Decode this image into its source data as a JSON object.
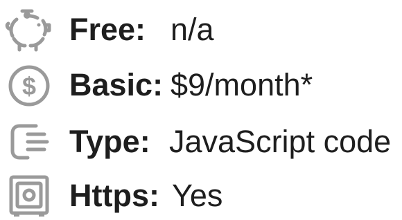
{
  "colors": {
    "icon": "#9a9a9a",
    "text": "#1e1e1e"
  },
  "rows": [
    {
      "icon": "piggy-bank-icon",
      "label": "Free:",
      "value": "n/a"
    },
    {
      "icon": "dollar-coin-icon",
      "label": "Basic:",
      "value": "$9/month*"
    },
    {
      "icon": "hand-code-icon",
      "label": "Type:",
      "value": "JavaScript code"
    },
    {
      "icon": "safe-lock-icon",
      "label": "Https:",
      "value": "Yes"
    }
  ]
}
